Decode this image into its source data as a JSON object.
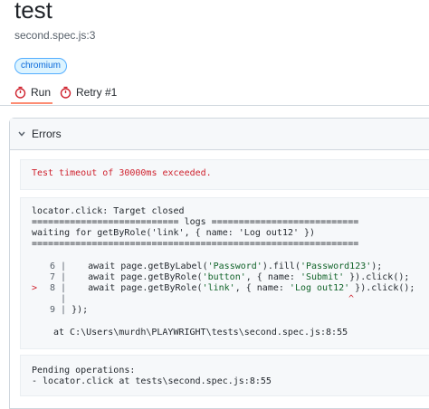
{
  "header": {
    "title": "test",
    "subtitle": "second.spec.js:3",
    "badge": "chromium"
  },
  "tabs": [
    {
      "label": "Run",
      "icon": "stopwatch-icon",
      "active": true
    },
    {
      "label": "Retry #1",
      "icon": "stopwatch-icon",
      "active": false
    }
  ],
  "errors": {
    "title": "Errors",
    "timeout_message": "Test timeout of 30000ms exceeded.",
    "log": {
      "line1": "locator.click: Target closed",
      "line2": "=========================== logs ===========================",
      "line3": "waiting for getByRole('link', { name: 'Log out12' })",
      "line4": "============================================================"
    },
    "code": {
      "row6": {
        "marker": "",
        "num": "6",
        "bar": "|",
        "pre": "    await page.getByLabel(",
        "s1": "'Password'",
        "mid": ").fill(",
        "s2": "'Password123'",
        "post": ");"
      },
      "row7": {
        "marker": "",
        "num": "7",
        "bar": "|",
        "pre": "    await page.getByRole(",
        "s1": "'button'",
        "mid": ", { name: ",
        "s2": "'Submit'",
        "post": " }).click();"
      },
      "row8": {
        "marker": ">",
        "num": "8",
        "bar": "|",
        "pre": "    await page.getByRole(",
        "s1": "'link'",
        "mid": ", { name: ",
        "s2": "'Log out12'",
        "post": " }).click();"
      },
      "caret_bar": "|",
      "caret": "^",
      "row9": {
        "num": "9",
        "bar": "|",
        "text": " });"
      }
    },
    "at_line": "at C:\\Users\\murdh\\PLAYWRIGHT\\tests\\second.spec.js:8:55",
    "pending_title": "Pending operations:",
    "pending_item": "- locator.click at tests\\second.spec.js:8:55"
  },
  "colors": {
    "accent_red": "#cf222e",
    "string_green": "#116329",
    "badge_blue": "#0969da",
    "tab_underline": "#fd8c73"
  }
}
